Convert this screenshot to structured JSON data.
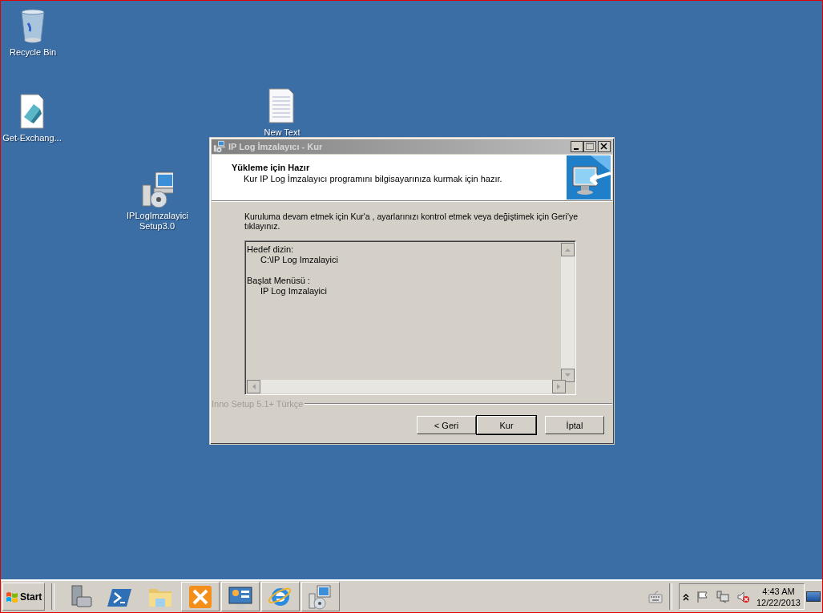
{
  "desktop_icons": [
    {
      "label": "Recycle Bin",
      "kind": "recycle"
    },
    {
      "label": "Get-Exchang...",
      "kind": "notepad"
    },
    {
      "label": "New Text",
      "kind": "textfile"
    },
    {
      "label": "IPLogImzalayici Setup3.0",
      "kind": "setup"
    }
  ],
  "window": {
    "title": "IP Log İmzalayıcı - Kur",
    "active": false,
    "header_title": "Yükleme için Hazır",
    "header_subtitle": "Kur IP Log İmzalayıcı programını bilgisayarınıza kurmak için hazır.",
    "instruction": "Kuruluma devam etmek için Kur'a , ayarlarınızı kontrol etmek veya değiştimek için Geri'ye tıklayınız.",
    "memo": [
      {
        "label": "Hedef dizin:",
        "value": "C:\\IP Log Imzalayici"
      },
      {
        "label": "Başlat Menüsü :",
        "value": "IP Log Imzalayici"
      }
    ],
    "footer": "Inno Setup 5.1+ Türkçe",
    "buttons": [
      {
        "label": "< Geri",
        "default": false
      },
      {
        "label": "Kur",
        "default": true
      },
      {
        "label": "İptal",
        "default": false
      }
    ]
  },
  "taskbar": {
    "start": "Start",
    "items": [
      {
        "kind": "server",
        "running": false
      },
      {
        "kind": "powershell",
        "running": false
      },
      {
        "kind": "folder",
        "running": false
      },
      {
        "kind": "exchange",
        "running": true
      },
      {
        "kind": "panel",
        "running": true
      },
      {
        "kind": "browser",
        "running": true
      },
      {
        "kind": "setup",
        "running": true
      }
    ],
    "clock_time": "4:43 AM",
    "clock_date": "12/22/2013"
  }
}
